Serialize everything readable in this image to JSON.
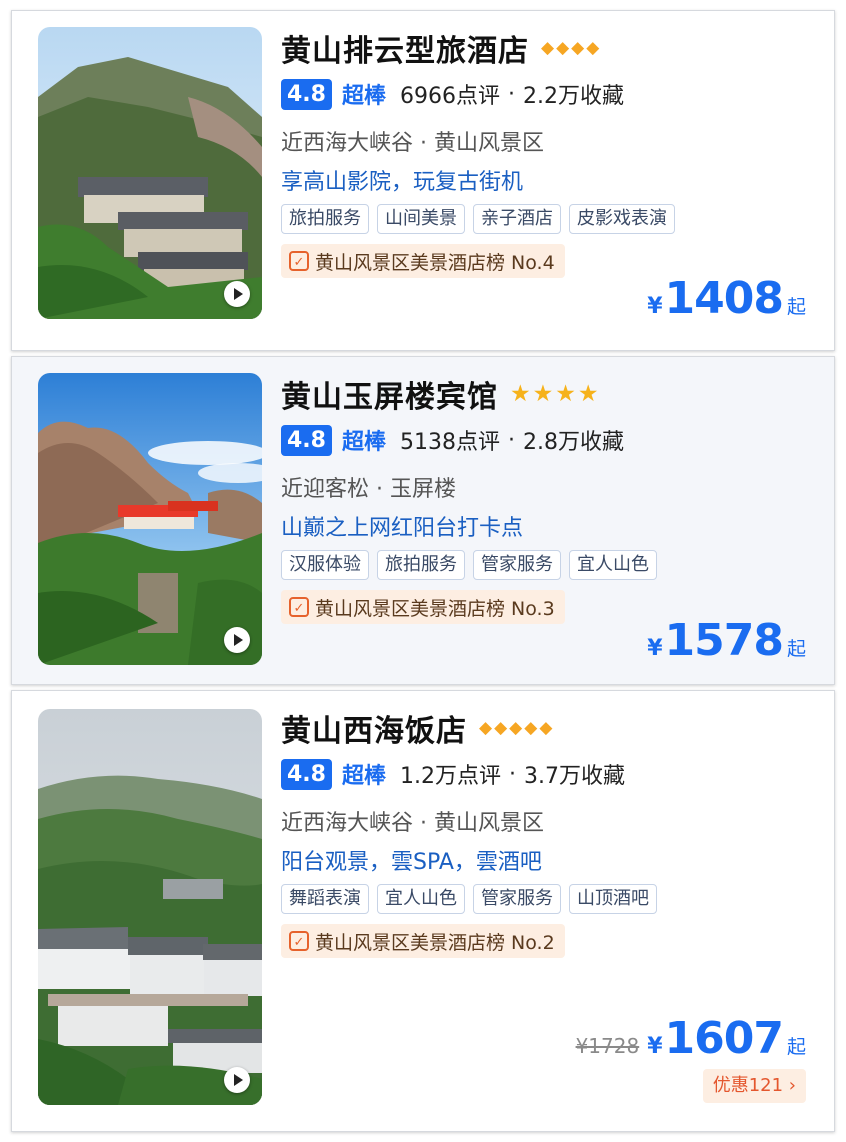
{
  "hotels": [
    {
      "name": "黄山排云型旅酒店",
      "grade_icon": "diamond-icon",
      "grade_count": 4,
      "score": "4.8",
      "level": "超棒",
      "reviews": "6966点评",
      "separator": "·",
      "favorites": "2.2万收藏",
      "location": "近西海大峡谷 · 黄山风景区",
      "highlight": "享高山影院，玩复古街机",
      "tags": [
        "旅拍服务",
        "山间美景",
        "亲子酒店",
        "皮影戏表演"
      ],
      "rank": "黄山风景区美景酒店榜 No.4",
      "currency": "¥",
      "price": "1408",
      "price_suffix": "起"
    },
    {
      "name": "黄山玉屏楼宾馆",
      "grade_icon": "star-icon",
      "grade_count": 4,
      "score": "4.8",
      "level": "超棒",
      "reviews": "5138点评",
      "separator": "·",
      "favorites": "2.8万收藏",
      "location": "近迎客松 · 玉屏楼",
      "highlight": "山巅之上网红阳台打卡点",
      "tags": [
        "汉服体验",
        "旅拍服务",
        "管家服务",
        "宜人山色"
      ],
      "rank": "黄山风景区美景酒店榜 No.3",
      "currency": "¥",
      "price": "1578",
      "price_suffix": "起"
    },
    {
      "name": "黄山西海饭店",
      "grade_icon": "diamond-icon",
      "grade_count": 5,
      "score": "4.8",
      "level": "超棒",
      "reviews": "1.2万点评",
      "separator": "·",
      "favorites": "3.7万收藏",
      "location": "近西海大峡谷 · 黄山风景区",
      "highlight": "阳台观景，雲SPA，雲酒吧",
      "tags": [
        "舞蹈表演",
        "宜人山色",
        "管家服务",
        "山顶酒吧"
      ],
      "rank": "黄山风景区美景酒店榜 No.2",
      "original_price": "¥1728",
      "currency": "¥",
      "price": "1607",
      "price_suffix": "起",
      "discount": "优惠121 ›"
    }
  ],
  "colors": {
    "accent": "#1a6cf0",
    "grade": "#f6a623",
    "rank_bg": "#fdeee2",
    "discount_text": "#e4572e"
  }
}
